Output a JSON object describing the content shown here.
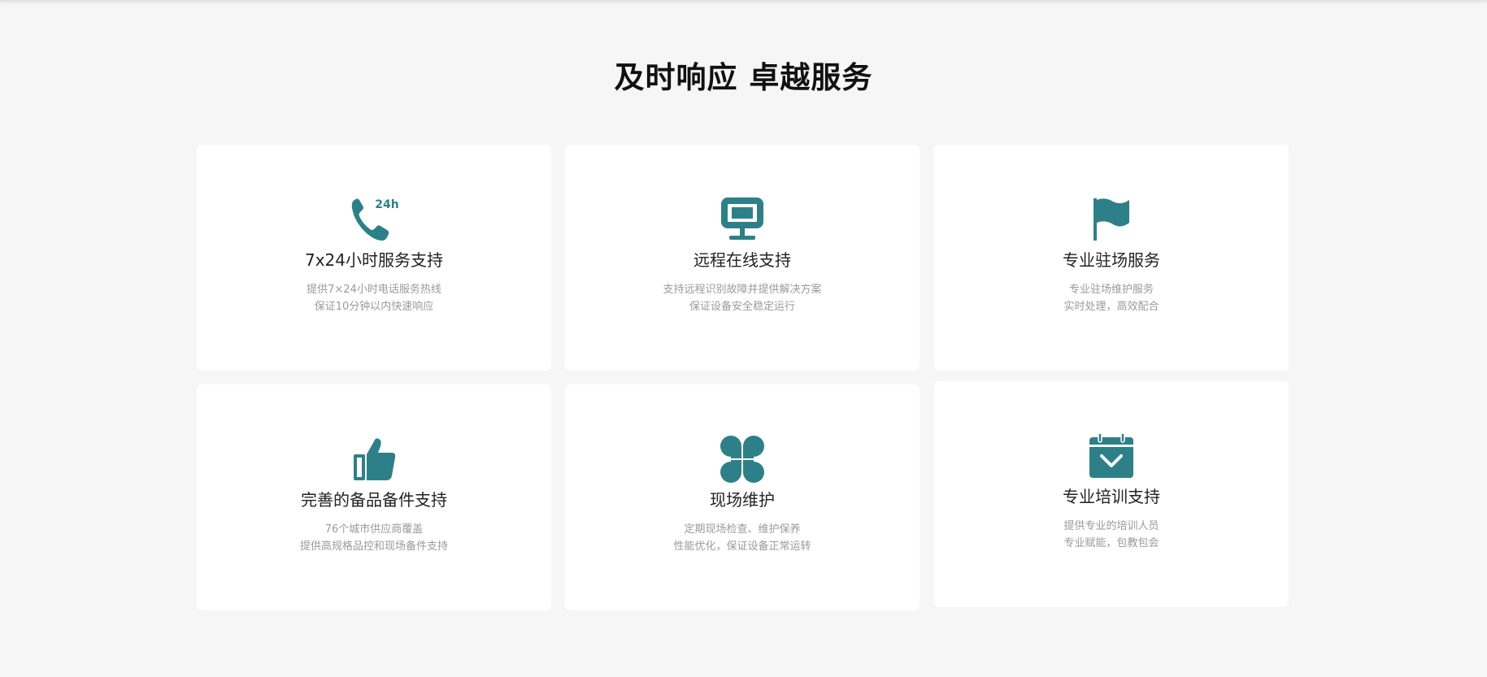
{
  "section": {
    "title": "及时响应 卓越服务"
  },
  "colors": {
    "accent": "#2e8088",
    "background": "#f6f6f6",
    "card": "#ffffff"
  },
  "cards": [
    {
      "icon": "phone-24h-icon",
      "title": "7x24小时服务支持",
      "line1": "提供7×24小时电话服务热线",
      "line2": "保证10分钟以内快速响应",
      "badge": "24h"
    },
    {
      "icon": "monitor-icon",
      "title": "远程在线支持",
      "line1": "支持远程识别故障并提供解决方案",
      "line2": "保证设备安全稳定运行"
    },
    {
      "icon": "flag-icon",
      "title": "专业驻场服务",
      "line1": "专业驻场维护服务",
      "line2": "实时处理，高效配合"
    },
    {
      "icon": "thumbs-up-icon",
      "title": "完善的备品备件支持",
      "line1": "76个城市供应商覆盖",
      "line2": "提供高规格品控和现场备件支持"
    },
    {
      "icon": "clover-icon",
      "title": "现场维护",
      "line1": "定期现场检查、维护保养",
      "line2": "性能优化，保证设备正常运转"
    },
    {
      "icon": "calendar-check-icon",
      "title": "专业培训支持",
      "line1": "提供专业的培训人员",
      "line2": "专业赋能，包教包会"
    }
  ]
}
